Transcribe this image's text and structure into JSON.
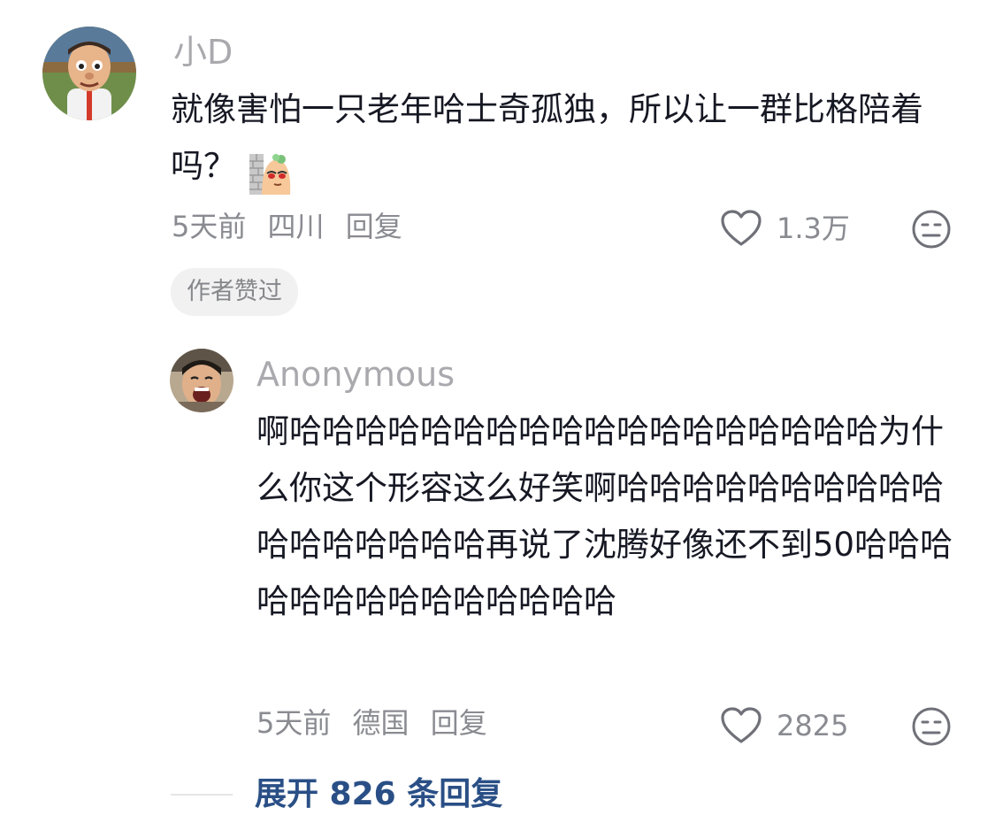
{
  "comment": {
    "username": "小D",
    "text": "就像害怕一只老年哈士奇孤独，所以让一群比格陪着吗？",
    "sticker_icon": "wall-peek-sticker",
    "meta": {
      "time": "5天前",
      "location": "四川",
      "reply_label": "回复"
    },
    "like_count": "1.3万",
    "author_liked_badge": "作者赞过"
  },
  "reply": {
    "username": "Anonymous",
    "text": "啊哈哈哈哈哈哈哈哈哈哈哈哈哈哈哈哈哈哈为什么你这个形容这么好笑啊哈哈哈哈哈哈哈哈哈哈哈哈哈哈哈哈哈再说了沈腾好像还不到50哈哈哈哈哈哈哈哈哈哈哈哈哈哈",
    "meta": {
      "time": "5天前",
      "location": "德国",
      "reply_label": "回复"
    },
    "like_count": "2825"
  },
  "expand_replies_label": "展开 826 条回复",
  "colors": {
    "link": "#2a4f86",
    "meta": "#8a8b91",
    "username": "#a9a9ae"
  }
}
